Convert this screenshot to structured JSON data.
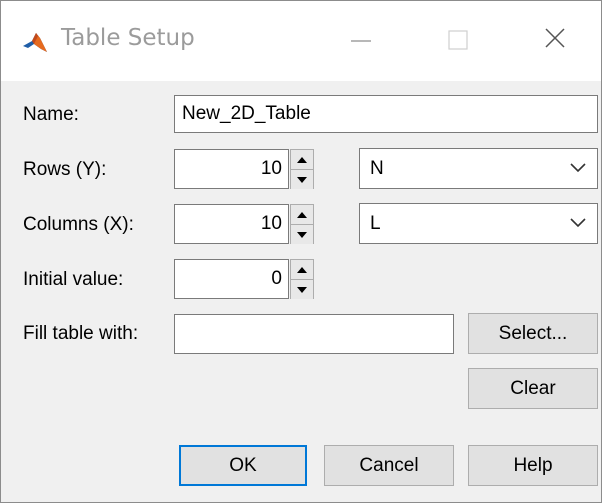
{
  "window": {
    "title": "Table Setup",
    "controls": [
      "minimize-icon",
      "maximize-icon",
      "close-icon"
    ]
  },
  "form": {
    "name": {
      "label": "Name:",
      "value": "New_2D_Table"
    },
    "rows": {
      "label": "Rows (Y):",
      "value": "10",
      "axis_selected": "N"
    },
    "columns": {
      "label": "Columns (X):",
      "value": "10",
      "axis_selected": "L"
    },
    "initial_value": {
      "label": "Initial value:",
      "value": "0"
    },
    "fill": {
      "label": "Fill table with:",
      "value": "",
      "select_label": "Select...",
      "clear_label": "Clear"
    }
  },
  "buttons": {
    "ok": "OK",
    "cancel": "Cancel",
    "help": "Help"
  },
  "colors": {
    "accent": "#0078d7",
    "dialog_bg": "#f0f0f0",
    "title_text": "#9b9b9b"
  }
}
